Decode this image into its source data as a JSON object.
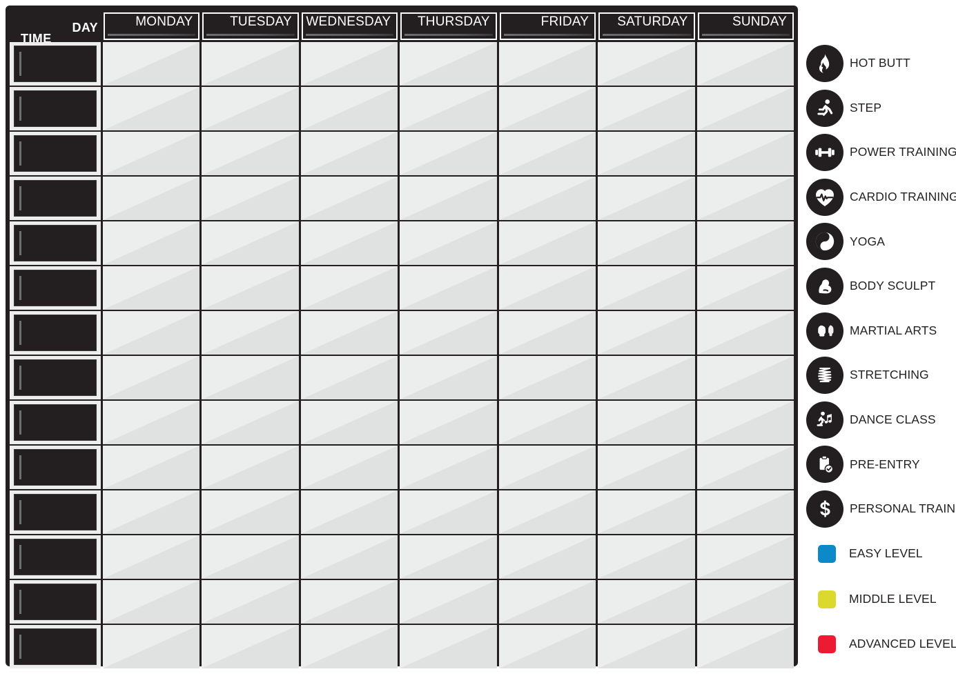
{
  "schedule": {
    "corner": {
      "day_label": "DAY",
      "time_label": "TIME"
    },
    "days": [
      {
        "label": "MONDAY"
      },
      {
        "label": "TUESDAY"
      },
      {
        "label": "WEDNESDAY"
      },
      {
        "label": "THURSDAY"
      },
      {
        "label": "FRIDAY"
      },
      {
        "label": "SATURDAY"
      },
      {
        "label": "SUNDAY"
      }
    ],
    "rows": [
      {
        "time": ""
      },
      {
        "time": ""
      },
      {
        "time": ""
      },
      {
        "time": ""
      },
      {
        "time": ""
      },
      {
        "time": ""
      },
      {
        "time": ""
      },
      {
        "time": ""
      },
      {
        "time": ""
      },
      {
        "time": ""
      },
      {
        "time": ""
      },
      {
        "time": ""
      },
      {
        "time": ""
      },
      {
        "time": ""
      }
    ],
    "row_count": 14,
    "colors": {
      "frame": "#231f20",
      "cell_light": "#eceded",
      "cell_shade": "#e0e1e1",
      "header_text": "#ffffff"
    }
  },
  "legend": {
    "activities": [
      {
        "label": "HOT BUTT",
        "icon": "flame-icon"
      },
      {
        "label": "STEP",
        "icon": "running-person-icon"
      },
      {
        "label": "POWER TRAINING",
        "icon": "dumbbell-icon"
      },
      {
        "label": "CARDIO TRAINING",
        "icon": "heart-pulse-icon"
      },
      {
        "label": "YOGA",
        "icon": "yin-yang-icon"
      },
      {
        "label": "BODY SCULPT",
        "icon": "flexed-bicep-icon"
      },
      {
        "label": "MARTIAL ARTS",
        "icon": "boxing-gloves-icon"
      },
      {
        "label": "STRETCHING",
        "icon": "spring-zigzag-icon"
      },
      {
        "label": "DANCE CLASS",
        "icon": "dancer-music-note-icon"
      },
      {
        "label": "PRE-ENTRY",
        "icon": "clipboard-check-icon"
      },
      {
        "label": "PERSONAL TRAINING",
        "icon": "dollar-sign-icon"
      }
    ],
    "levels": [
      {
        "label": "EASY LEVEL",
        "color": "#0d88c9",
        "icon": "level-swatch-easy"
      },
      {
        "label": "MIDDLE LEVEL",
        "color": "#dbd92e",
        "icon": "level-swatch-middle"
      },
      {
        "label": "ADVANCED LEVEL",
        "color": "#ec1b34",
        "icon": "level-swatch-advanced"
      }
    ]
  }
}
